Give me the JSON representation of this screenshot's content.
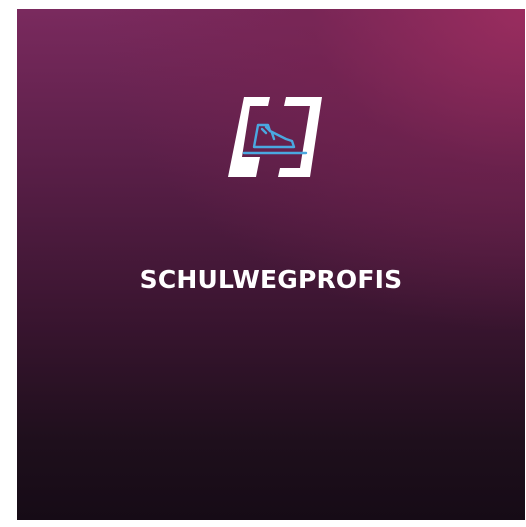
{
  "app": {
    "title": "SCHULWEGPROFIS",
    "logo_icon": "shoe-in-frame-icon"
  },
  "colors": {
    "background_top": "#7a2a5e",
    "background_bottom": "#160b16",
    "accent": "#4aa8e0",
    "text": "#ffffff"
  }
}
